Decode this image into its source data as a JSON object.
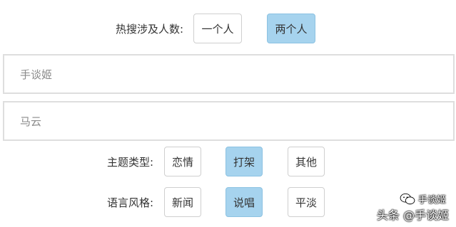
{
  "hot_search": {
    "label": "热搜涉及人数:",
    "options": [
      "一个人",
      "两个人"
    ],
    "selected": "两个人"
  },
  "inputs": [
    {
      "value": "手谈姬"
    },
    {
      "value": "马云"
    }
  ],
  "theme_type": {
    "label": "主题类型:",
    "options": [
      "恋情",
      "打架",
      "其他"
    ],
    "selected": "打架"
  },
  "language_style": {
    "label": "语言风格:",
    "options": [
      "新闻",
      "说唱",
      "平淡"
    ],
    "selected": "说唱"
  },
  "watermark": {
    "top_text": "手谈姬",
    "bottom_text": "头条 @手谈姬",
    "icon": "wechat-icon"
  },
  "colors": {
    "selected_bg": "#a6d3ee",
    "border": "#cfcfcf",
    "input_border": "#dedede"
  }
}
